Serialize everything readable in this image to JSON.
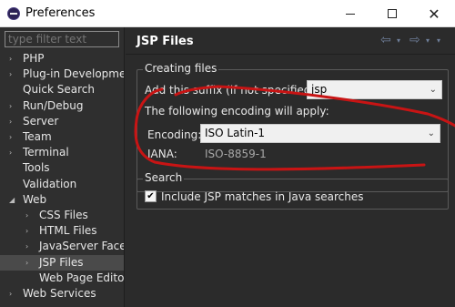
{
  "window": {
    "title": "Preferences",
    "minimize_icon": "minimize-icon",
    "maximize_icon": "maximize-icon",
    "close_glyph": "✕"
  },
  "filter": {
    "placeholder": "type filter text"
  },
  "tree": [
    {
      "label": "PHP",
      "expand": "›"
    },
    {
      "label": "Plug-in Developme",
      "expand": "›"
    },
    {
      "label": "Quick Search",
      "expand": ""
    },
    {
      "label": "Run/Debug",
      "expand": "›"
    },
    {
      "label": "Server",
      "expand": "›"
    },
    {
      "label": "Team",
      "expand": "›"
    },
    {
      "label": "Terminal",
      "expand": "›"
    },
    {
      "label": "Tools",
      "expand": ""
    },
    {
      "label": "Validation",
      "expand": ""
    },
    {
      "label": "Web",
      "expand": "◢"
    },
    {
      "label": "CSS Files",
      "expand": "›"
    },
    {
      "label": "HTML Files",
      "expand": "›"
    },
    {
      "label": "JavaServer Face",
      "expand": "›"
    },
    {
      "label": "JSP Files",
      "expand": "›"
    },
    {
      "label": "Web Page Edito",
      "expand": ""
    },
    {
      "label": "Web Services",
      "expand": "›"
    }
  ],
  "page": {
    "title": "JSP Files",
    "nav_back": "⇦",
    "nav_forward": "⇨",
    "dropdown": "▾"
  },
  "creating": {
    "group_label": "Creating files",
    "suffix_label": "Add this suffix (if not specified):",
    "suffix_value": "jsp",
    "encoding_note": "The following encoding will apply:",
    "encoding_label": "Encoding:",
    "encoding_value": "ISO Latin-1",
    "iana_label": "IANA:",
    "iana_value": "ISO-8859-1"
  },
  "search": {
    "group_label": "Search",
    "include_label": "Include JSP matches in Java searches",
    "checked_glyph": "✔"
  },
  "colors": {
    "annotation": "#c81414",
    "background": "#2b2b2b",
    "selection": "#4a4a4a"
  }
}
